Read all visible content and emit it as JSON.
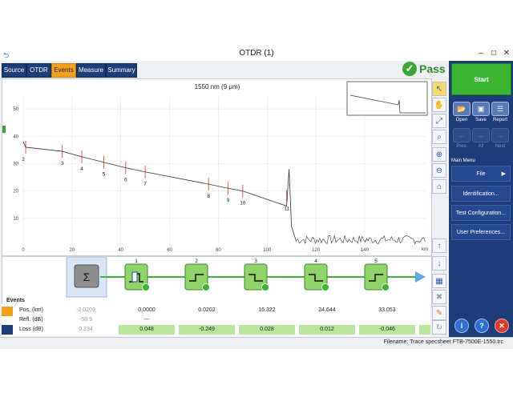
{
  "window": {
    "title": "OTDR (1)"
  },
  "tabs": [
    {
      "label": "Source",
      "active": false
    },
    {
      "label": "OTDR",
      "active": false
    },
    {
      "label": "Events",
      "active": true
    },
    {
      "label": "Measure",
      "active": false
    },
    {
      "label": "Summary",
      "active": false
    }
  ],
  "status": {
    "pass_label": "Pass",
    "color": "#3aa535"
  },
  "graph": {
    "title": "1550 nm (9 μm)",
    "x_unit": "km",
    "y_ticks": [
      "50",
      "40",
      "30",
      "20",
      "10"
    ],
    "x_ticks": [
      "0",
      "20",
      "40",
      "60",
      "80",
      "100",
      "120",
      "140"
    ],
    "event_numbers": [
      "2",
      "3",
      "4",
      "5",
      "6",
      "7",
      "8",
      "9",
      "10",
      "11"
    ]
  },
  "chart_data": {
    "type": "line",
    "x": [
      0,
      1,
      16,
      24,
      33,
      42,
      50,
      76,
      84,
      90,
      108,
      109,
      110,
      112,
      125,
      140,
      155,
      165
    ],
    "values": [
      38,
      36,
      34.5,
      32.5,
      30.5,
      28.5,
      27,
      22.5,
      21,
      20,
      14.5,
      28,
      7,
      1.5,
      1.8,
      1.5,
      1.8,
      1.5
    ],
    "xlim": [
      0,
      165
    ],
    "ylim": [
      0,
      55
    ],
    "grid": true
  },
  "events": {
    "section_label": "Events",
    "rows": [
      {
        "label": "Pos. (km)",
        "values": [
          "-2.0209",
          "0.0000",
          "0.0202",
          "16.322",
          "24.644",
          "33.053"
        ]
      },
      {
        "label": "Refl. (dB)",
        "values": [
          "-50.9",
          "---",
          "",
          "",
          "",
          ""
        ]
      },
      {
        "label": "Loss (dB)",
        "values": [
          "0.234",
          "0.048",
          "-0.249",
          "0.028",
          "0.012",
          "-0.046"
        ]
      }
    ],
    "strip_numbers": [
      "1",
      "2",
      "3",
      "4",
      "5"
    ],
    "sum_symbol": "Σ"
  },
  "right_panel": {
    "start_label": "Start",
    "file_buttons": [
      {
        "label": "Open",
        "icon": "folder-icon"
      },
      {
        "label": "Save",
        "icon": "floppy-icon"
      },
      {
        "label": "Report",
        "icon": "report-icon"
      }
    ],
    "nav_buttons": [
      {
        "label": "Prev.",
        "icon": "prev-icon"
      },
      {
        "label": "All",
        "icon": "all-icon"
      },
      {
        "label": "Next",
        "icon": "next-icon"
      }
    ],
    "main_menu_label": "Main Menu",
    "menu_items": [
      "File",
      "Identification...",
      "Test Configuration...",
      "User Preferences..."
    ]
  },
  "statusbar": {
    "filename": "Filename:  Trace specsheet FTB-7500E-1550.trc"
  }
}
